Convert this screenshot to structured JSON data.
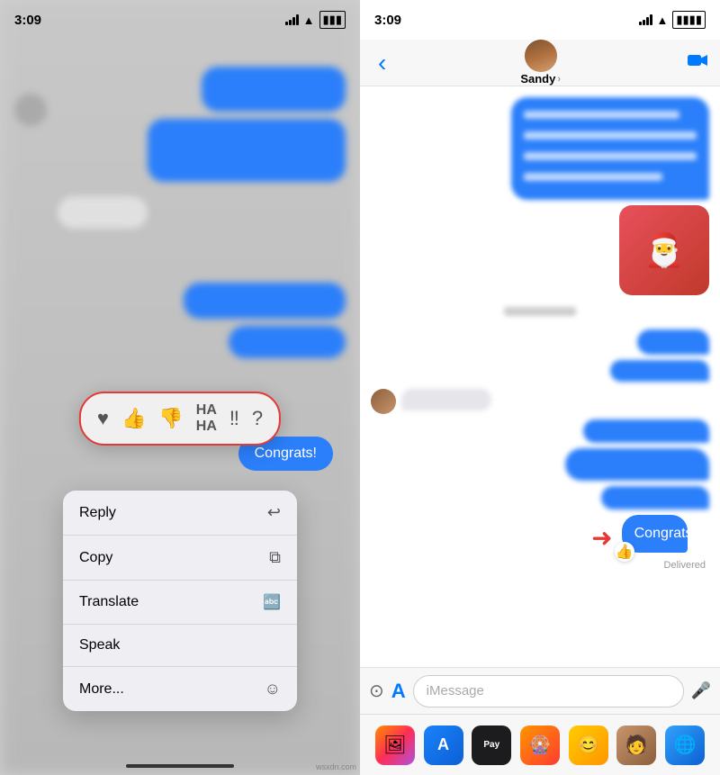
{
  "left": {
    "status_time": "3:09",
    "congrats_label": "Congrats!",
    "reaction_emojis": [
      "♥",
      "👍",
      "👎",
      "😂",
      "‼",
      "?"
    ],
    "context_menu": {
      "items": [
        {
          "label": "Reply",
          "icon": "↩"
        },
        {
          "label": "Copy",
          "icon": "⧉"
        },
        {
          "label": "Translate",
          "icon": "🔤"
        },
        {
          "label": "Speak",
          "icon": ""
        },
        {
          "label": "More...",
          "icon": "☺"
        }
      ]
    },
    "home_indicator": ""
  },
  "right": {
    "status_time": "3:09",
    "contact_name": "Sandy",
    "back_label": "‹",
    "video_icon": "📹",
    "input_placeholder": "iMessage",
    "delivered_label": "Delivered",
    "congrats_bubble": "Congrats!",
    "dock_icons": [
      {
        "name": "photos",
        "emoji": "🖼"
      },
      {
        "name": "appstore",
        "emoji": "A"
      },
      {
        "name": "applepay",
        "emoji": "Pay"
      },
      {
        "name": "stickers",
        "emoji": "🎡"
      },
      {
        "name": "memoji",
        "emoji": "😊"
      },
      {
        "name": "apps-person",
        "emoji": "🧑"
      },
      {
        "name": "world",
        "emoji": "🌐"
      }
    ]
  }
}
